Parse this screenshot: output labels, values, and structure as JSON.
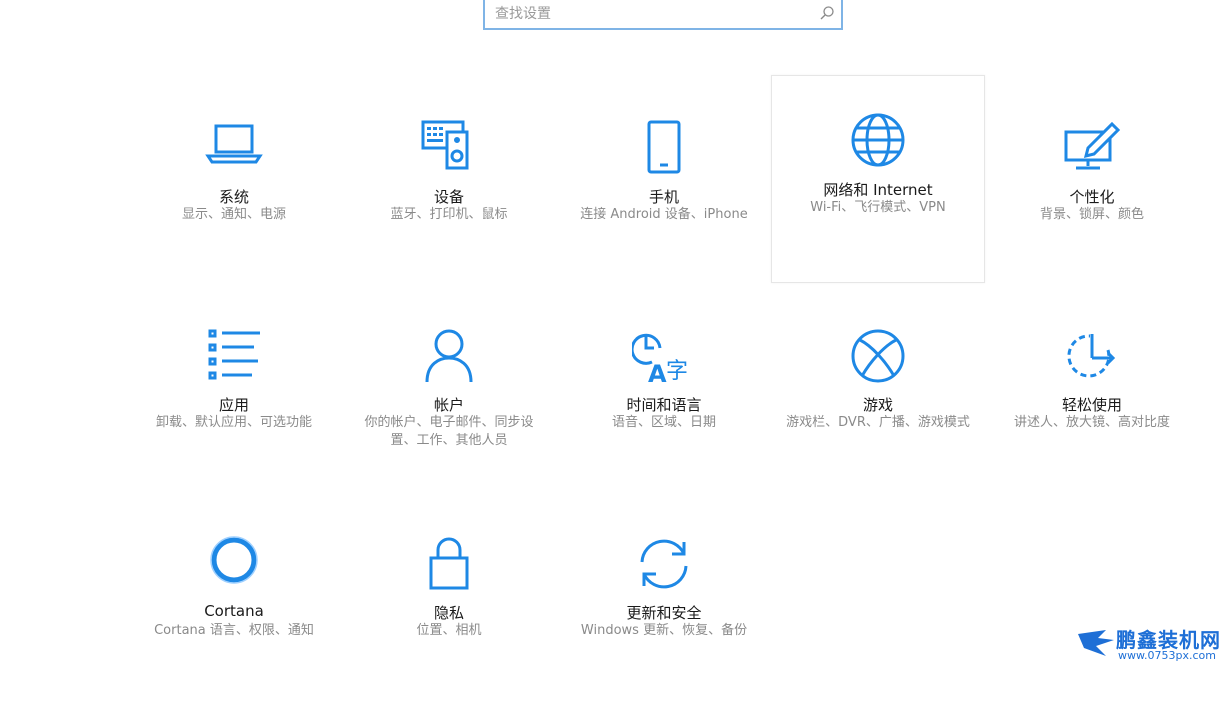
{
  "search": {
    "placeholder": "查找设置"
  },
  "tiles": [
    {
      "title": "系统",
      "desc": "显示、通知、电源",
      "icon": "laptop-icon"
    },
    {
      "title": "设备",
      "desc": "蓝牙、打印机、鼠标",
      "icon": "devices-icon"
    },
    {
      "title": "手机",
      "desc": "连接 Android 设备、iPhone",
      "icon": "phone-icon"
    },
    {
      "title": "网络和 Internet",
      "desc": "Wi-Fi、飞行模式、VPN",
      "icon": "globe-icon"
    },
    {
      "title": "个性化",
      "desc": "背景、锁屏、颜色",
      "icon": "personalization-icon"
    },
    {
      "title": "应用",
      "desc": "卸载、默认应用、可选功能",
      "icon": "apps-list-icon"
    },
    {
      "title": "帐户",
      "desc": "你的帐户、电子邮件、同步设置、工作、其他人员",
      "icon": "person-icon"
    },
    {
      "title": "时间和语言",
      "desc": "语音、区域、日期",
      "icon": "time-language-icon"
    },
    {
      "title": "游戏",
      "desc": "游戏栏、DVR、广播、游戏模式",
      "icon": "xbox-icon"
    },
    {
      "title": "轻松使用",
      "desc": "讲述人、放大镜、高对比度",
      "icon": "ease-of-access-icon"
    },
    {
      "title": "Cortana",
      "desc": "Cortana 语言、权限、通知",
      "icon": "cortana-icon"
    },
    {
      "title": "隐私",
      "desc": "位置、相机",
      "icon": "lock-icon"
    },
    {
      "title": "更新和安全",
      "desc": "Windows 更新、恢复、备份",
      "icon": "update-icon"
    }
  ],
  "watermark": {
    "brand": "鹏鑫装机网",
    "url": "www.0753px.com"
  },
  "colors": {
    "accent": "#1e88e5",
    "selected_border": "#e6e6e6"
  }
}
